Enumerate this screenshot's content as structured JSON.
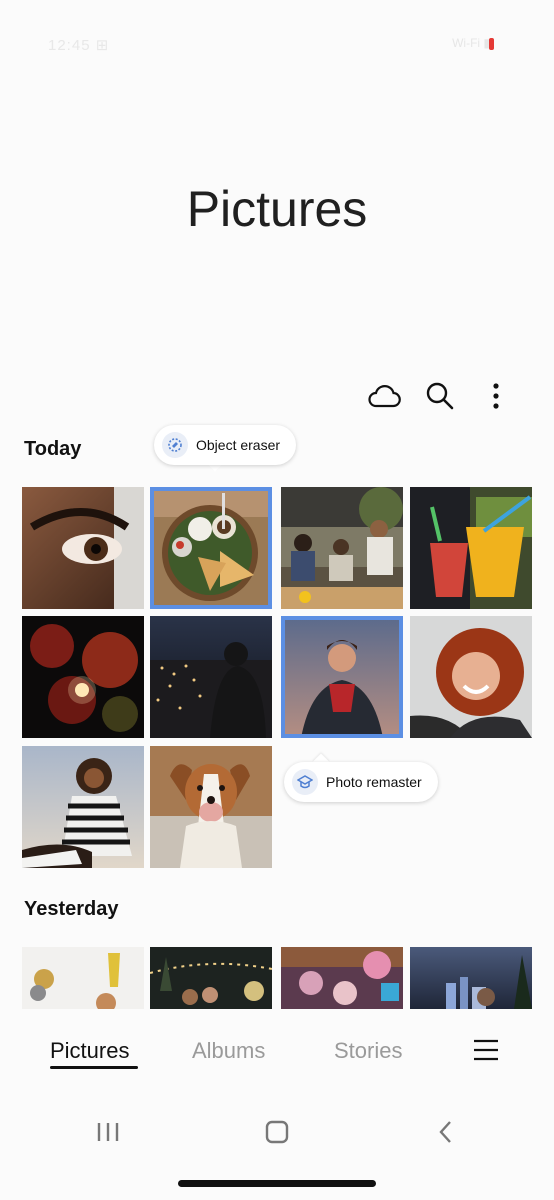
{
  "status_bar": {
    "time": "12:45 ⊞",
    "icons": "Wi-Fi ▮"
  },
  "page": {
    "title": "Pictures"
  },
  "toolbar": {
    "cloud_icon": "cloud-icon",
    "search_icon": "search-icon",
    "more_icon": "more-options-icon"
  },
  "sections": [
    {
      "label": "Today"
    },
    {
      "label": "Yesterday"
    }
  ],
  "tips": {
    "object_eraser": "Object eraser",
    "photo_remaster": "Photo remaster"
  },
  "photos_today": [
    {
      "desc": "eye-closeup"
    },
    {
      "desc": "food-plate",
      "selected": true
    },
    {
      "desc": "friends-outdoor"
    },
    {
      "desc": "drinks"
    },
    {
      "desc": "red-leaves-night"
    },
    {
      "desc": "city-night-silhouette"
    },
    {
      "desc": "portrait-city",
      "selected": true
    },
    {
      "desc": "woman-curly-hair"
    },
    {
      "desc": "couple-striped"
    },
    {
      "desc": "dog"
    }
  ],
  "tabs": [
    {
      "label": "Pictures",
      "active": true
    },
    {
      "label": "Albums"
    },
    {
      "label": "Stories"
    }
  ],
  "menu_icon": "hamburger-menu-icon",
  "nav": {
    "recents": "recents-icon",
    "home": "home-icon",
    "back": "back-icon"
  },
  "colors": {
    "accent": "#5c8fe3",
    "background": "#fbfbfb",
    "text": "#111111"
  }
}
